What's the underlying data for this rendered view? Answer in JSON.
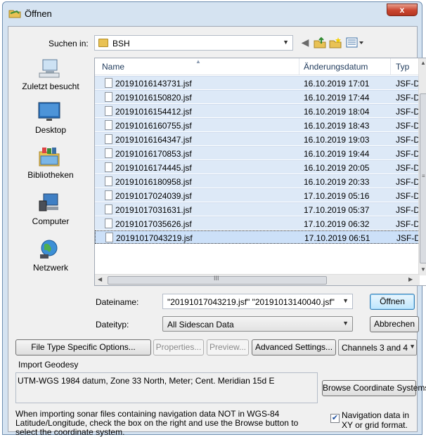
{
  "window": {
    "title": "Öffnen",
    "close_label": "x"
  },
  "lookin": {
    "label": "Suchen in:",
    "value": "BSH"
  },
  "places": [
    {
      "label": "Zuletzt besucht",
      "icon": "recent-places-icon"
    },
    {
      "label": "Desktop",
      "icon": "desktop-icon"
    },
    {
      "label": "Bibliotheken",
      "icon": "libraries-icon"
    },
    {
      "label": "Computer",
      "icon": "computer-icon"
    },
    {
      "label": "Netzwerk",
      "icon": "network-icon"
    }
  ],
  "columns": {
    "name": "Name",
    "date": "Änderungsdatum",
    "type": "Typ"
  },
  "files": [
    {
      "name": "20191016143731.jsf",
      "date": "16.10.2019 17:01",
      "type": "JSF-Da"
    },
    {
      "name": "20191016150820.jsf",
      "date": "16.10.2019 17:44",
      "type": "JSF-Da"
    },
    {
      "name": "20191016154412.jsf",
      "date": "16.10.2019 18:04",
      "type": "JSF-Da"
    },
    {
      "name": "20191016160755.jsf",
      "date": "16.10.2019 18:43",
      "type": "JSF-Da"
    },
    {
      "name": "20191016164347.jsf",
      "date": "16.10.2019 19:03",
      "type": "JSF-Da"
    },
    {
      "name": "20191016170853.jsf",
      "date": "16.10.2019 19:44",
      "type": "JSF-Da"
    },
    {
      "name": "20191016174445.jsf",
      "date": "16.10.2019 20:05",
      "type": "JSF-Da"
    },
    {
      "name": "20191016180958.jsf",
      "date": "16.10.2019 20:33",
      "type": "JSF-Da"
    },
    {
      "name": "20191017024039.jsf",
      "date": "17.10.2019 05:16",
      "type": "JSF-Da"
    },
    {
      "name": "20191017031631.jsf",
      "date": "17.10.2019 05:37",
      "type": "JSF-Da"
    },
    {
      "name": "20191017035626.jsf",
      "date": "17.10.2019 06:32",
      "type": "JSF-Da"
    },
    {
      "name": "20191017043219.jsf",
      "date": "17.10.2019 06:51",
      "type": "JSF-Da"
    }
  ],
  "filename": {
    "label": "Dateiname:",
    "value": "\"20191017043219.jsf\" \"20191013140040.jsf\" '"
  },
  "filetype": {
    "label": "Dateityp:",
    "value": "All Sidescan Data"
  },
  "buttons": {
    "open": "Öffnen",
    "cancel": "Abbrechen",
    "file_type_options": "File Type Specific Options...",
    "properties": "Properties...",
    "preview": "Preview...",
    "advanced": "Advanced Settings...",
    "browse_coords": "Browse Coordinate Systems..."
  },
  "channels": {
    "value": "Channels 3 and 4"
  },
  "geodesy": {
    "group_title": "Import Geodesy",
    "coord_system": "UTM-WGS 1984 datum, Zone 33 North, Meter; Cent. Meridian 15d E",
    "note": "When importing sonar files containing navigation data NOT in WGS-84 Latitude/Longitude, check the box on the right and use the Browse button to select the coordinate system.",
    "checkbox_label": "Navigation data in XY or grid format.",
    "checkbox_checked": true
  },
  "scroll": {
    "h_grip": "III"
  }
}
